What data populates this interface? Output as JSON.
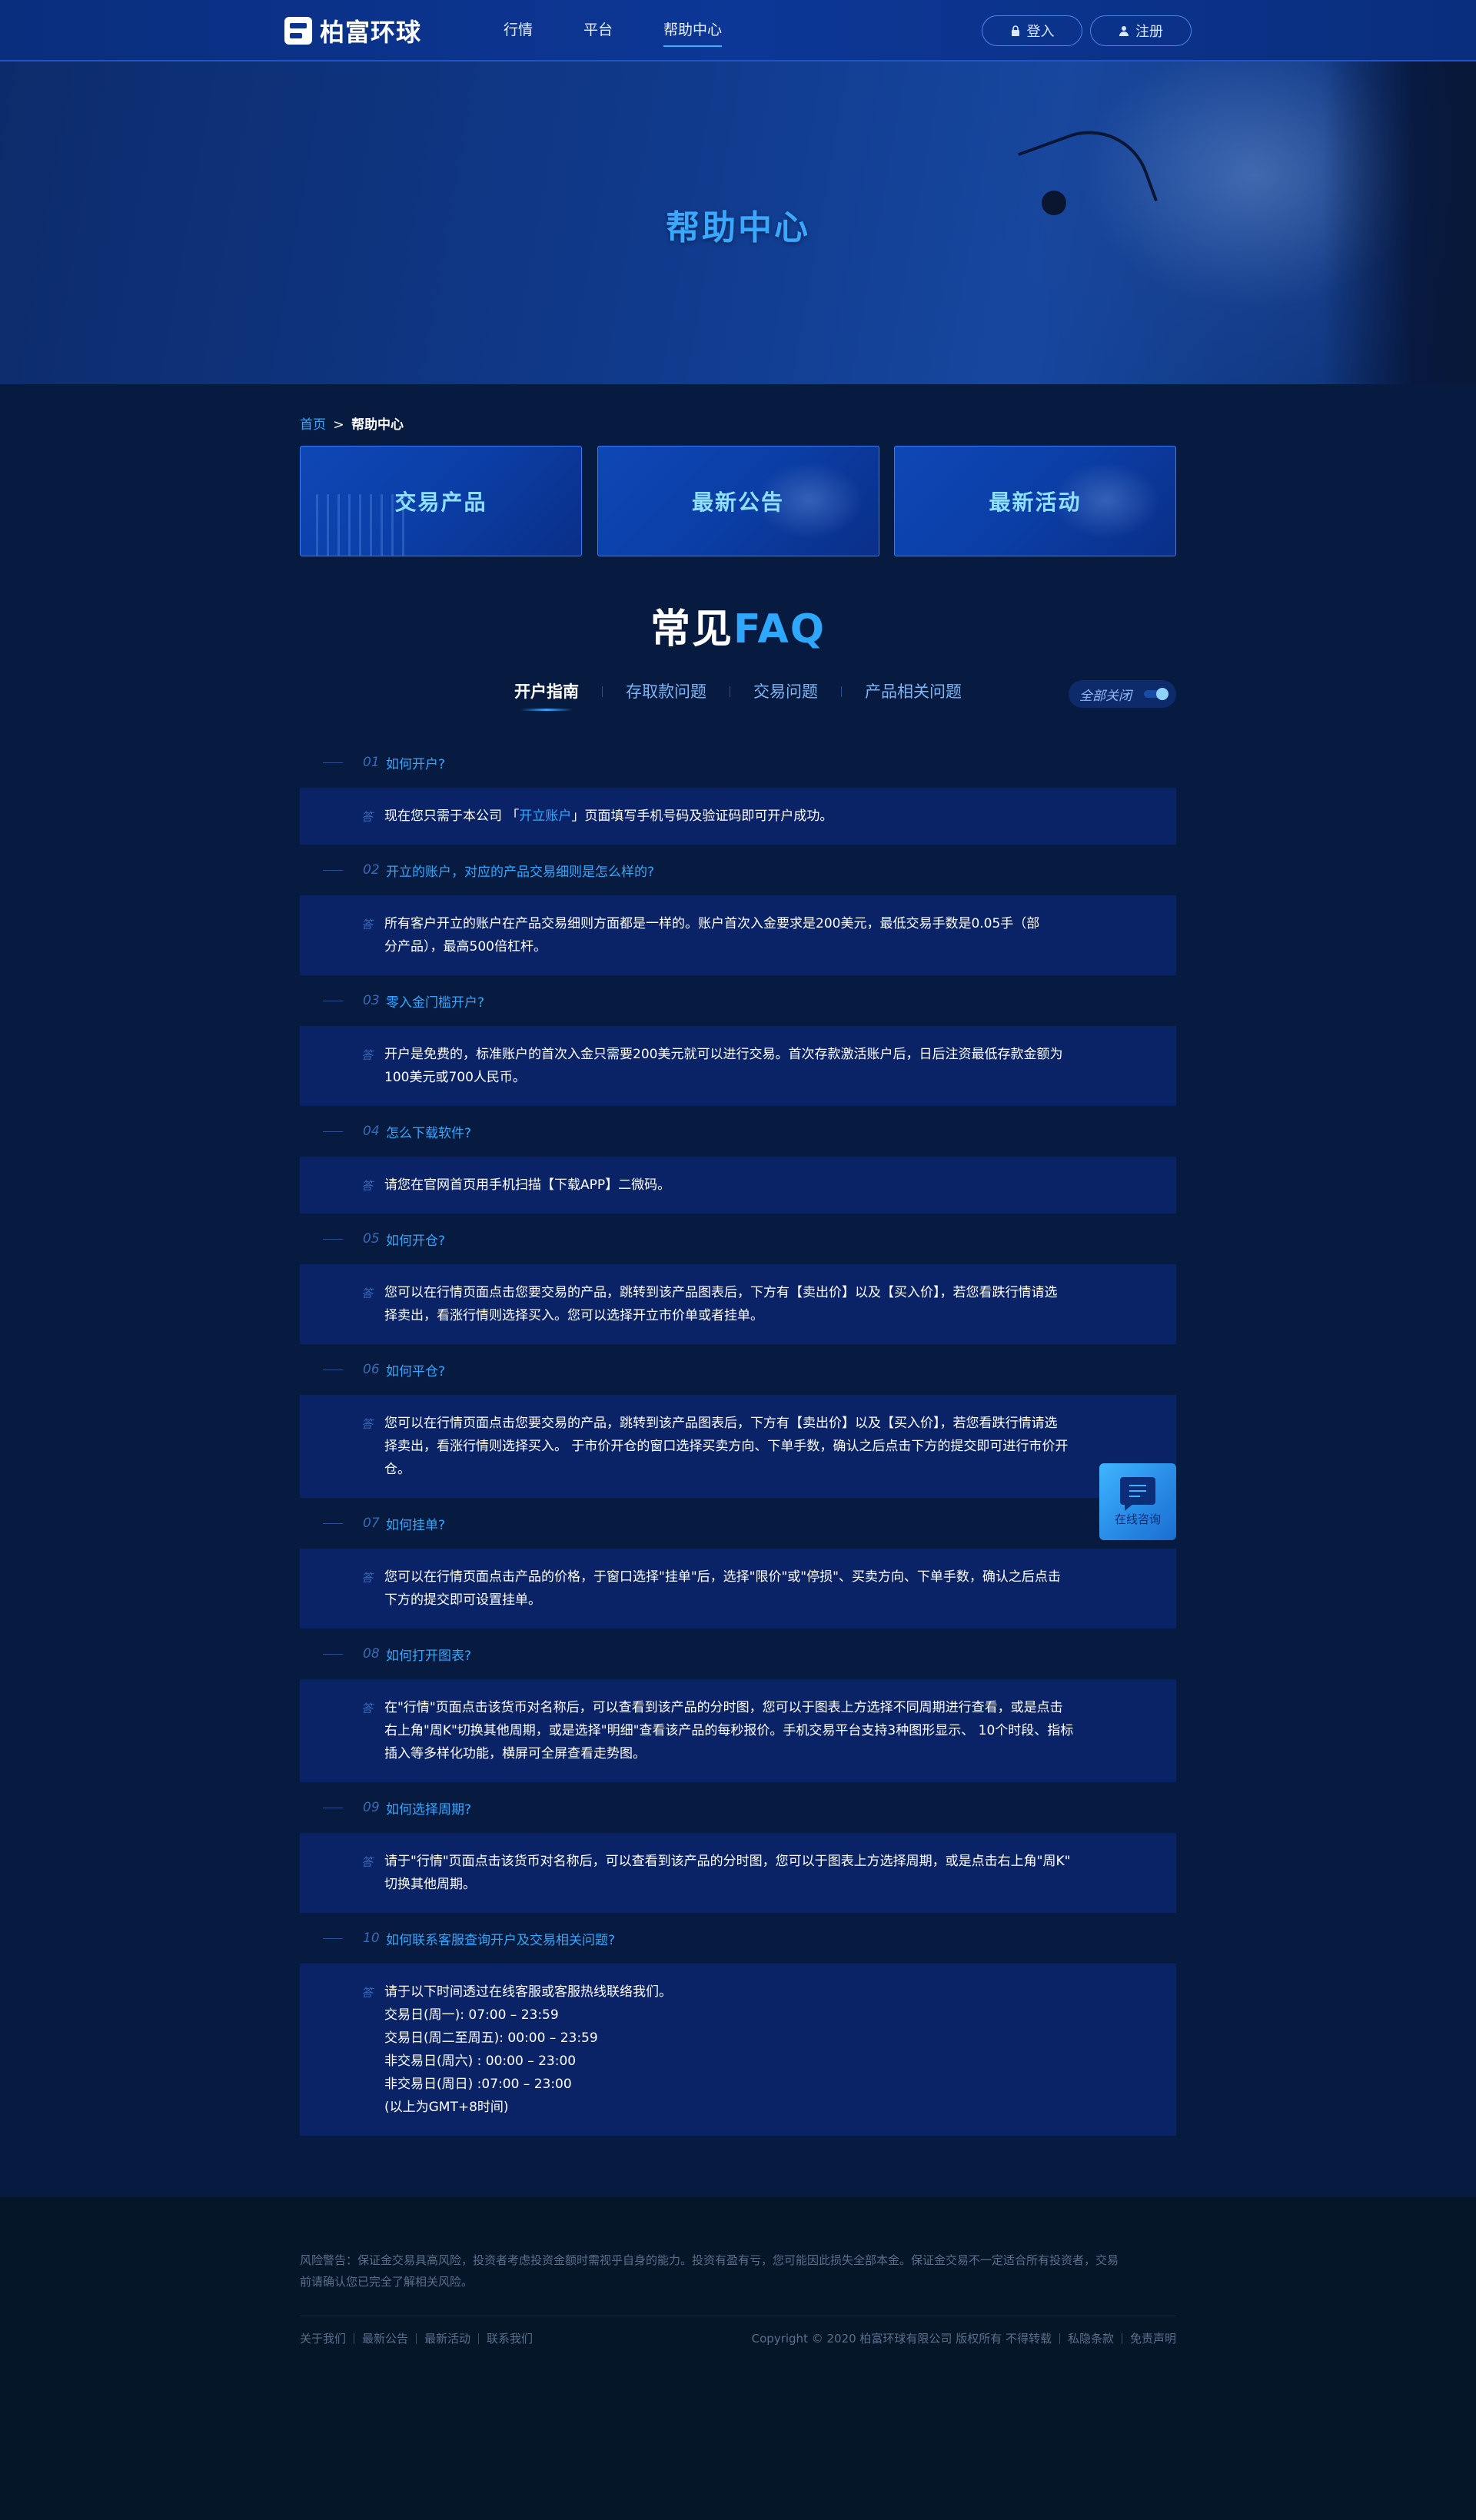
{
  "header": {
    "logo_text": "柏富环球",
    "nav": [
      {
        "label": "行情"
      },
      {
        "label": "平台"
      },
      {
        "label": "帮助中心"
      }
    ],
    "login_label": "登入",
    "register_label": "注册"
  },
  "banner": {
    "title": "帮助中心"
  },
  "breadcrumb": {
    "home": "首页",
    "separator": ">",
    "current": "帮助中心"
  },
  "cards": [
    {
      "label": "交易产品"
    },
    {
      "label": "最新公告"
    },
    {
      "label": "最新活动"
    }
  ],
  "faq": {
    "title_a": "常见",
    "title_b": "FAQ",
    "tabs": [
      {
        "label": "开户指南"
      },
      {
        "label": "存取款问题"
      },
      {
        "label": "交易问题"
      },
      {
        "label": "产品相关问题"
      }
    ],
    "toggle_label": "全部关闭",
    "answer_mark": "答",
    "items": [
      {
        "num": "01",
        "q": "如何开户?",
        "a_pre": "现在您只需于本公司 「",
        "a_link": "开立账户",
        "a_post": "」页面填写手机号码及验证码即可开户成功。"
      },
      {
        "num": "02",
        "q": "开立的账户，对应的产品交易细则是怎么样的?",
        "a": [
          "所有客户开立的账户在产品交易细则方面都是一样的。账户首次入金要求是200美元，最低交易手数是0.05手（部",
          "分产品），最高500倍杠杆。"
        ]
      },
      {
        "num": "03",
        "q": "零入金门槛开户?",
        "a": [
          "开户是免费的，标准账户的首次入金只需要200美元就可以进行交易。首次存款激活账户后，日后注资最低存款金额为",
          "100美元或700人民币。"
        ]
      },
      {
        "num": "04",
        "q": "怎么下载软件?",
        "a": [
          "请您在官网首页用手机扫描【下载APP】二微码。"
        ]
      },
      {
        "num": "05",
        "q": "如何开仓?",
        "a": [
          "您可以在行情页面点击您要交易的产品，跳转到该产品图表后，下方有【卖出价】以及【买入价】，若您看跌行情请选",
          "择卖出，看涨行情则选择买入。您可以选择开立市价单或者挂单。"
        ]
      },
      {
        "num": "06",
        "q": "如何平仓?",
        "a": [
          "您可以在行情页面点击您要交易的产品，跳转到该产品图表后，下方有【卖出价】以及【买入价】，若您看跌行情请选",
          "择卖出，看涨行情则选择买入。   于市价开仓的窗口选择买卖方向、下单手数，确认之后点击下方的提交即可进行市价开",
          "仓。"
        ]
      },
      {
        "num": "07",
        "q": "如何挂单?",
        "a": [
          "您可以在行情页面点击产品的价格，于窗口选择\"挂单\"后，选择\"限价\"或\"停损\"、买卖方向、下单手数，确认之后点击",
          "下方的提交即可设置挂单。"
        ]
      },
      {
        "num": "08",
        "q": "如何打开图表?",
        "a": [
          "在\"行情\"页面点击该货币对名称后，可以查看到该产品的分时图，您可以于图表上方选择不同周期进行查看，或是点击",
          "右上角\"周K\"切换其他周期，或是选择\"明细\"查看该产品的每秒报价。手机交易平台支持3种图形显示、  10个时段、指标",
          "插入等多样化功能，横屏可全屏查看走势图。"
        ]
      },
      {
        "num": "09",
        "q": "如何选择周期?",
        "a": [
          "请于\"行情\"页面点击该货币对名称后，可以查看到该产品的分时图，您可以于图表上方选择周期，或是点击右上角\"周K\"",
          "切换其他周期。"
        ]
      },
      {
        "num": "10",
        "q": "如何联系客服查询开户及交易相关问题?",
        "a": [
          "请于以下时间透过在线客服或客服热线联络我们。",
          "交易日(周一): 07:00 – 23:59",
          "交易日(周二至周五): 00:00 – 23:59",
          "非交易日(周六) : 00:00 – 23:00",
          "非交易日(周日) :07:00 – 23:00",
          "(以上为GMT+8时间)"
        ]
      }
    ]
  },
  "float_consult": {
    "label": "在线咨询"
  },
  "footer": {
    "risk_line1": "风险警告：保证金交易具高风险，投资者考虑投资金额时需视乎自身的能力。投资有盈有亏，您可能因此损失全部本金。保证金交易不一定适合所有投资者，交易",
    "risk_line2": "前请确认您已完全了解相关风险。",
    "links": [
      {
        "label": "关于我们"
      },
      {
        "label": "最新公告"
      },
      {
        "label": "最新活动"
      },
      {
        "label": "联系我们"
      }
    ],
    "copyright": "Copyright © 2020 柏富环球有限公司 版权所有 不得转载",
    "privacy": "私隐条款",
    "disclaimer": "免责声明"
  },
  "colors": {
    "accent": "#35a7ff",
    "panel": "#0a2266",
    "background": "#071a3f",
    "footer": "#051629"
  },
  "icons": {
    "login": "lock-icon",
    "register": "user-icon",
    "consult": "chat-icon"
  }
}
